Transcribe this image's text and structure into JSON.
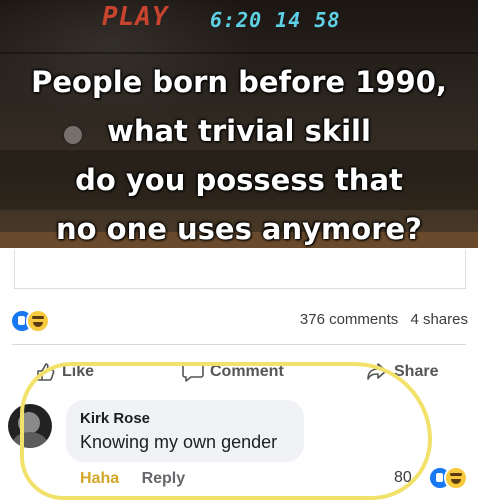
{
  "meme": {
    "display_play": "PLAY",
    "display_time": "6:20 14 58",
    "caption_lines": [
      "People born before 1990,",
      "what trivial skill",
      "do you possess that",
      "no one uses anymore?"
    ]
  },
  "stats": {
    "comments": "376 comments",
    "shares": "4 shares",
    "reactions": [
      "like-icon",
      "haha-icon"
    ]
  },
  "actions": {
    "like": "Like",
    "comment": "Comment",
    "share": "Share"
  },
  "comment": {
    "author": "Kirk Rose",
    "text": "Knowing my own gender",
    "reaction_label": "Haha",
    "reply_label": "Reply",
    "reaction_count": "80"
  },
  "colors": {
    "like_blue": "#1877f2",
    "haha_yellow": "#f7c93c",
    "highlight_yellow": "#f2e26b"
  }
}
